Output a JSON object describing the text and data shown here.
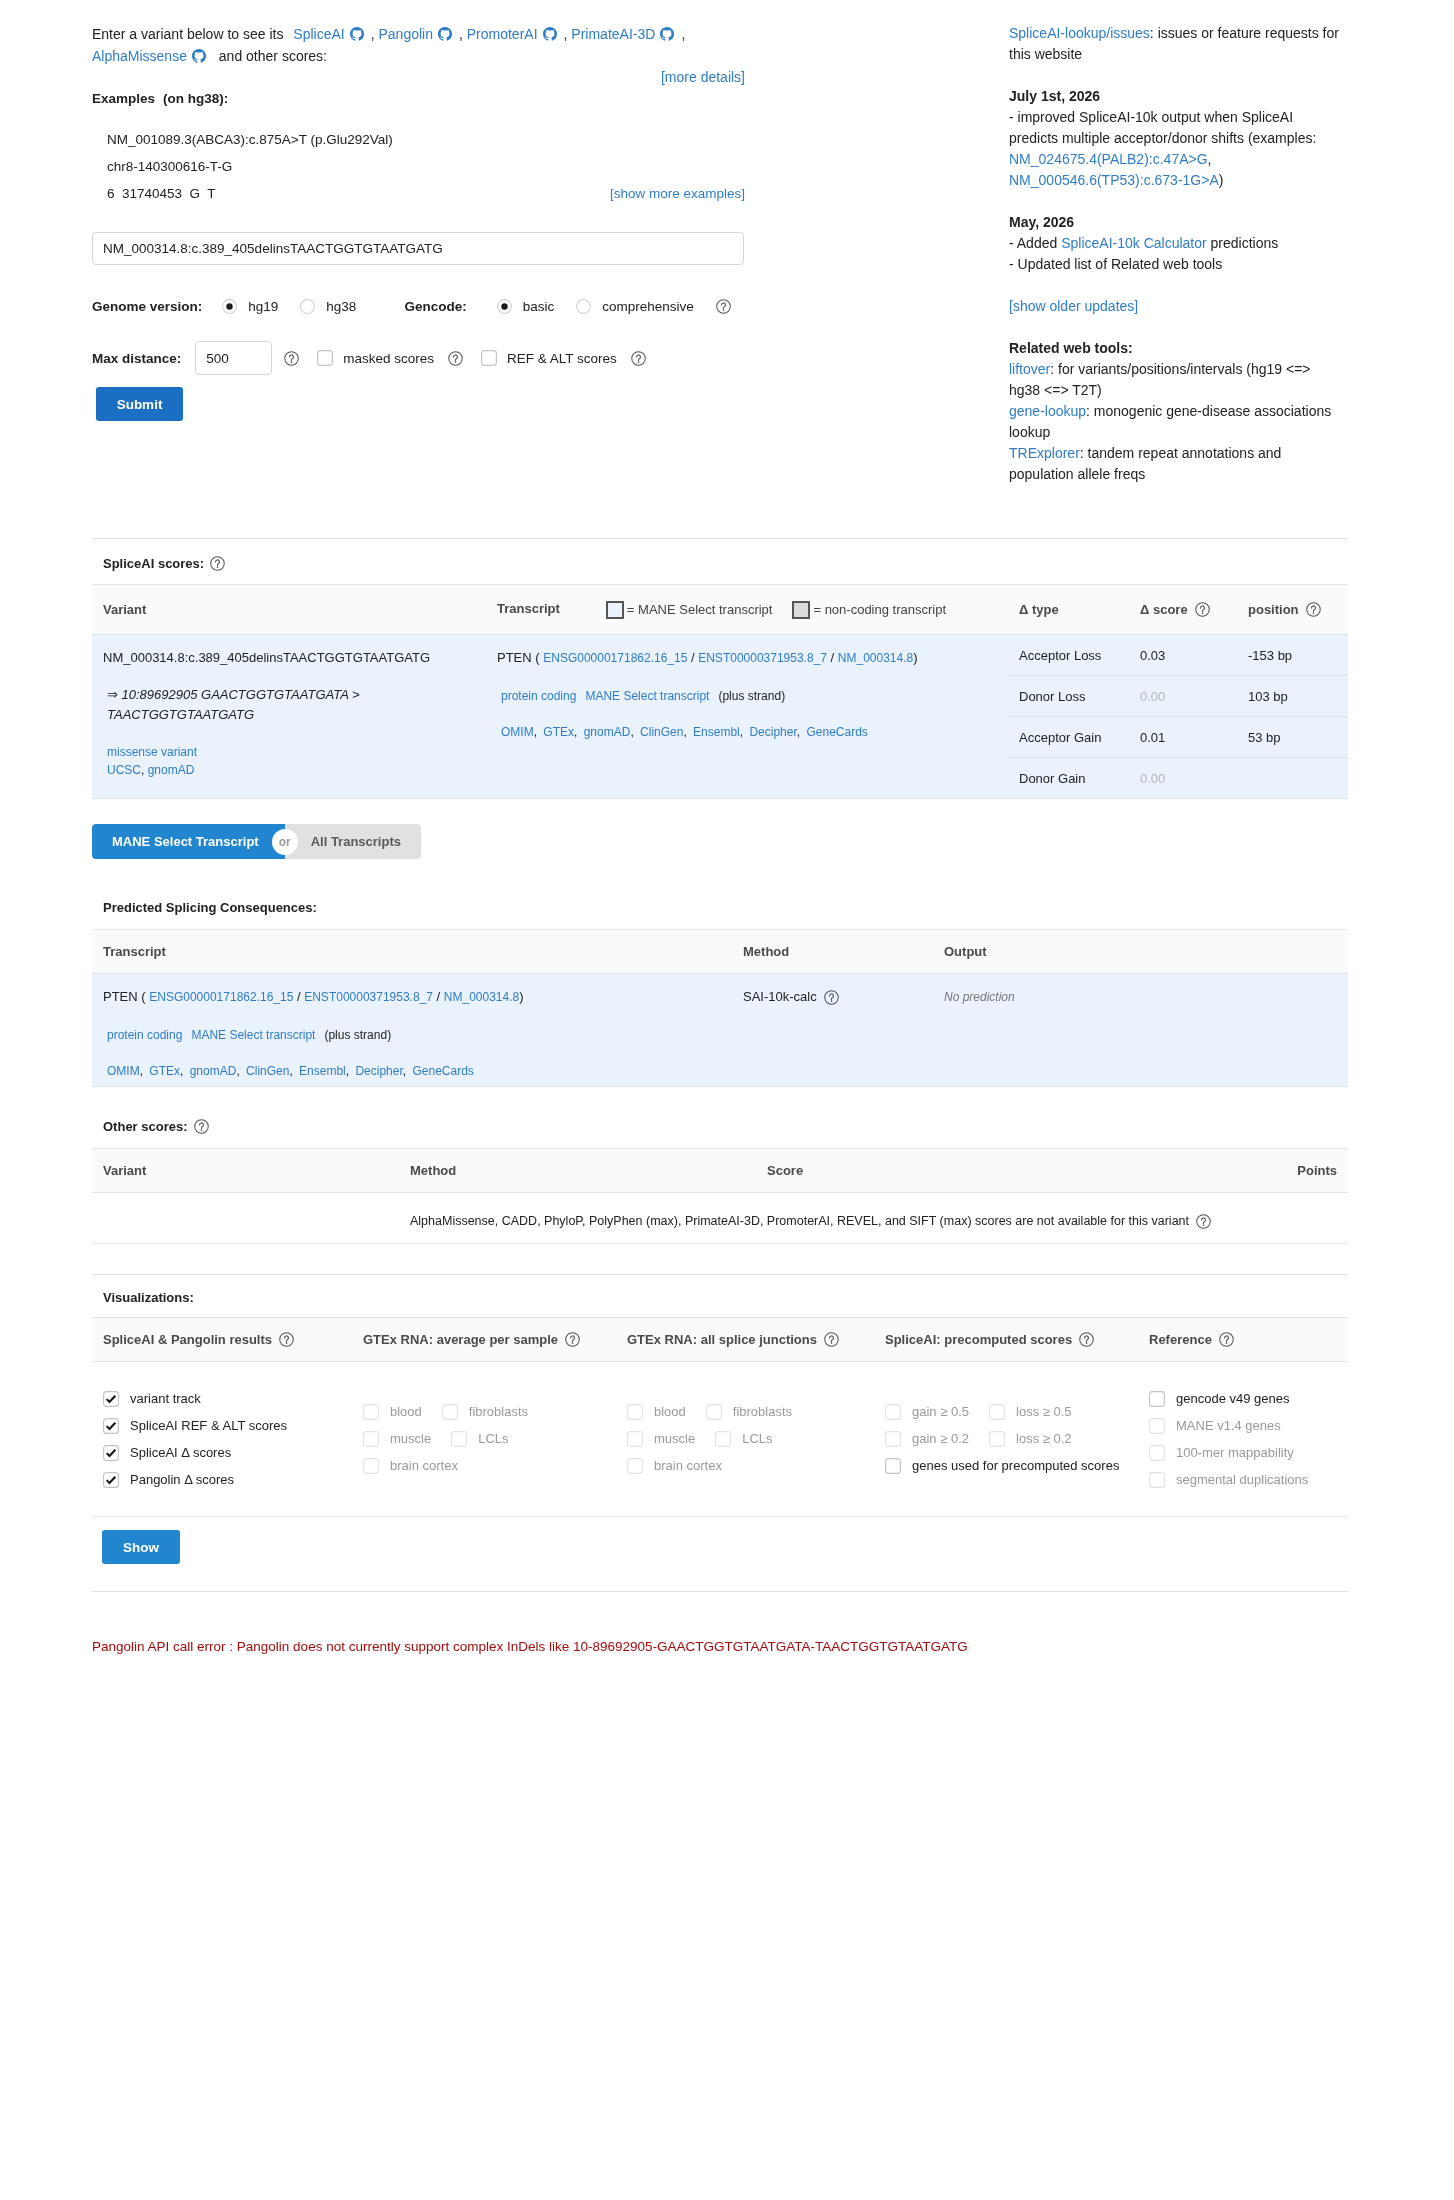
{
  "intro": {
    "lead": "Enter a variant below to see its",
    "tools": [
      {
        "name": "SpliceAI",
        "suffix": ","
      },
      {
        "name": "Pangolin",
        "suffix": ","
      },
      {
        "name": "PromoterAI",
        "suffix": ","
      },
      {
        "name": "PrimateAI-3D",
        "suffix": ","
      },
      {
        "name": "AlphaMissense"
      }
    ],
    "tail": "and other scores:",
    "more_details": "[more details]"
  },
  "examples": {
    "label": "Examples",
    "note": "(on hg38):",
    "items": [
      "NM_001089.3(ABCA3):c.875A>T (p.Glu292Val)",
      "chr8-140300616-T-G",
      "6  31740453  G  T"
    ],
    "more": "[show more examples]"
  },
  "variant_input": {
    "value": "NM_000314.8:c.389_405delinsTAACTGGTGTAATGATG"
  },
  "genome": {
    "label": "Genome version:",
    "options": [
      {
        "label": "hg19",
        "selected": true
      },
      {
        "label": "hg38",
        "selected": false
      }
    ]
  },
  "gencode": {
    "label": "Gencode:",
    "options": [
      {
        "label": "basic",
        "selected": true
      },
      {
        "label": "comprehensive",
        "selected": false
      }
    ]
  },
  "max_distance": {
    "label": "Max distance:",
    "value": "500"
  },
  "options": [
    {
      "label": "masked scores",
      "checked": false
    },
    {
      "label": "REF & ALT scores",
      "checked": false
    }
  ],
  "submit": "Submit",
  "sidebar": {
    "issues": [
      {
        "kind": "link",
        "text": "SpliceAI-lookup/issues"
      },
      {
        "kind": "text",
        "text": ": issues or feature requests for this website"
      }
    ],
    "updates": [
      {
        "date": "July 1st, 2026",
        "lines": [
          [
            {
              "kind": "text",
              "text": "- improved SpliceAI-10k output when SpliceAI predicts multiple acceptor/donor shifts (examples: "
            },
            {
              "kind": "link",
              "text": "NM_024675.4(PALB2):c.47A>G"
            },
            {
              "kind": "text",
              "text": ", "
            },
            {
              "kind": "link",
              "text": "NM_000546.6(TP53):c.673-1G>A"
            },
            {
              "kind": "text",
              "text": ")"
            }
          ]
        ]
      },
      {
        "date": "May, 2026",
        "lines": [
          [
            {
              "kind": "text",
              "text": "- Added "
            },
            {
              "kind": "link",
              "text": "SpliceAI-10k Calculator"
            },
            {
              "kind": "text",
              "text": " predictions"
            }
          ],
          [
            {
              "kind": "text",
              "text": "- Updated list of Related web tools"
            }
          ]
        ]
      }
    ],
    "older": "[show older updates]",
    "related": {
      "title": "Related web tools:",
      "items": [
        [
          {
            "kind": "link",
            "text": "liftover"
          },
          {
            "kind": "text",
            "text": ": for variants/positions/intervals (hg19 <=> hg38 <=> T2T)"
          }
        ],
        [
          {
            "kind": "link",
            "text": "gene-lookup"
          },
          {
            "kind": "text",
            "text": ": monogenic gene-disease associations lookup"
          }
        ],
        [
          {
            "kind": "link",
            "text": "TRExplorer"
          },
          {
            "kind": "text",
            "text": ": tandem repeat annotations and population allele freqs"
          }
        ]
      ]
    }
  },
  "spliceai": {
    "title": "SpliceAI scores:",
    "columns": [
      "Variant",
      "Transcript",
      "Δ type",
      "Δ score",
      "position"
    ],
    "legend": [
      {
        "label": "= MANE Select transcript",
        "color": "#eaf2fd"
      },
      {
        "label": "= non-coding transcript",
        "color": "#dcdcdc"
      }
    ],
    "rows": [
      {
        "mane_select": true,
        "variant": "NM_000314.8:c.389_405delinsTAACTGGTGTAATGATG",
        "normalized": "⇒ 10:89692905 GAACTGGTGTAATGATA > TAACTGGTGTAATGATG",
        "consequence": "missense variant",
        "variant_links": [
          {
            "kind": "link",
            "text": "UCSC"
          },
          {
            "kind": "text",
            "text": ", "
          },
          {
            "kind": "link",
            "text": "gnomAD"
          }
        ],
        "transcript": [
          [
            {
              "kind": "text",
              "text": "PTEN ( "
            },
            {
              "kind": "link",
              "text": "ENSG00000171862.16_15"
            },
            {
              "kind": "text",
              "text": " / "
            },
            {
              "kind": "link",
              "text": "ENST00000371953.8_7"
            },
            {
              "kind": "text",
              "text": " / "
            },
            {
              "kind": "link",
              "text": "NM_000314.8"
            },
            {
              "kind": "text",
              "text": ")"
            }
          ],
          [
            {
              "kind": "link",
              "text": "protein coding"
            },
            {
              "kind": "link",
              "text": "MANE Select transcript"
            },
            {
              "kind": "text",
              "text": "(plus strand)"
            }
          ],
          [
            {
              "kind": "link",
              "text": "OMIM"
            },
            {
              "kind": "text",
              "text": ", "
            },
            {
              "kind": "link",
              "text": "GTEx"
            },
            {
              "kind": "text",
              "text": ", "
            },
            {
              "kind": "link",
              "text": "gnomAD"
            },
            {
              "kind": "text",
              "text": ", "
            },
            {
              "kind": "link",
              "text": "ClinGen"
            },
            {
              "kind": "text",
              "text": ", "
            },
            {
              "kind": "link",
              "text": "Ensembl"
            },
            {
              "kind": "text",
              "text": ", "
            },
            {
              "kind": "link",
              "text": "Decipher"
            },
            {
              "kind": "text",
              "text": ", "
            },
            {
              "kind": "link",
              "text": "GeneCards"
            }
          ]
        ],
        "scores": [
          {
            "type": "Acceptor Loss",
            "score": "0.03",
            "position": "-153 bp",
            "dimmed": false
          },
          {
            "type": "Donor Loss",
            "score": "0.00",
            "position": "103 bp",
            "dimmed": true
          },
          {
            "type": "Acceptor Gain",
            "score": "0.01",
            "position": "53 bp",
            "dimmed": false
          },
          {
            "type": "Donor Gain",
            "score": "0.00",
            "dimmed": true
          }
        ]
      }
    ]
  },
  "toggle": {
    "options": [
      {
        "label": "MANE Select Transcript",
        "selected": true
      },
      {
        "label": "All Transcripts",
        "selected": false
      }
    ],
    "separator": "or"
  },
  "consequences": {
    "title": "Predicted Splicing Consequences:",
    "columns": [
      "Transcript",
      "Method",
      "Output"
    ],
    "rows": [
      {
        "mane_select": true,
        "transcript": [
          [
            {
              "kind": "text",
              "text": "PTEN ( "
            },
            {
              "kind": "link",
              "text": "ENSG00000171862.16_15"
            },
            {
              "kind": "text",
              "text": " / "
            },
            {
              "kind": "link",
              "text": "ENST00000371953.8_7"
            },
            {
              "kind": "text",
              "text": " / "
            },
            {
              "kind": "link",
              "text": "NM_000314.8"
            },
            {
              "kind": "text",
              "text": ")"
            }
          ],
          [
            {
              "kind": "link",
              "text": "protein coding"
            },
            {
              "kind": "link",
              "text": "MANE Select transcript"
            },
            {
              "kind": "text",
              "text": "(plus strand)"
            }
          ],
          [
            {
              "kind": "link",
              "text": "OMIM"
            },
            {
              "kind": "text",
              "text": ", "
            },
            {
              "kind": "link",
              "text": "GTEx"
            },
            {
              "kind": "text",
              "text": ", "
            },
            {
              "kind": "link",
              "text": "gnomAD"
            },
            {
              "kind": "text",
              "text": ", "
            },
            {
              "kind": "link",
              "text": "ClinGen"
            },
            {
              "kind": "text",
              "text": ", "
            },
            {
              "kind": "link",
              "text": "Ensembl"
            },
            {
              "kind": "text",
              "text": ", "
            },
            {
              "kind": "link",
              "text": "Decipher"
            },
            {
              "kind": "text",
              "text": ", "
            },
            {
              "kind": "link",
              "text": "GeneCards"
            }
          ]
        ],
        "method": "SAI-10k-calc",
        "output": "No prediction"
      }
    ]
  },
  "other_scores": {
    "title": "Other scores:",
    "columns": [
      "Variant",
      "Method",
      "Score",
      "Points"
    ],
    "message": "AlphaMissense, CADD, PhyloP, PolyPhen (max), PrimateAI-3D, PromoterAI, REVEL, and SIFT (max) scores are not available for this variant"
  },
  "visualizations": {
    "title": "Visualizations:",
    "groups": [
      {
        "title": "SpliceAI & Pangolin results",
        "items": [
          {
            "label": "variant track",
            "checked": true,
            "disabled": false
          },
          {
            "label": "SpliceAI REF & ALT scores",
            "checked": true,
            "disabled": false
          },
          {
            "label": "SpliceAI Δ scores",
            "checked": true,
            "disabled": false
          },
          {
            "label": "Pangolin Δ scores",
            "checked": true,
            "disabled": false
          }
        ]
      },
      {
        "title": "GTEx RNA: average per sample",
        "items": [
          {
            "label": "blood",
            "checked": false,
            "disabled": true
          },
          {
            "label": "fibroblasts",
            "checked": false,
            "disabled": true
          },
          {
            "label": "muscle",
            "checked": false,
            "disabled": true
          },
          {
            "label": "LCLs",
            "checked": false,
            "disabled": true
          },
          {
            "label": "brain cortex",
            "checked": false,
            "disabled": true
          }
        ]
      },
      {
        "title": "GTEx RNA: all splice junctions",
        "items": [
          {
            "label": "blood",
            "checked": false,
            "disabled": true
          },
          {
            "label": "fibroblasts",
            "checked": false,
            "disabled": true
          },
          {
            "label": "muscle",
            "checked": false,
            "disabled": true
          },
          {
            "label": "LCLs",
            "checked": false,
            "disabled": true
          },
          {
            "label": "brain cortex",
            "checked": false,
            "disabled": true
          }
        ]
      },
      {
        "title": "SpliceAI: precomputed scores",
        "items": [
          {
            "label": "gain ≥ 0.5",
            "checked": false,
            "disabled": true
          },
          {
            "label": "loss ≥ 0.5",
            "checked": false,
            "disabled": true
          },
          {
            "label": "gain ≥ 0.2",
            "checked": false,
            "disabled": true
          },
          {
            "label": "loss ≥ 0.2",
            "checked": false,
            "disabled": true
          },
          {
            "label": "genes used for precomputed scores",
            "checked": false,
            "disabled": false
          }
        ]
      },
      {
        "title": "Reference",
        "items": [
          {
            "label": "gencode v49 genes",
            "checked": false,
            "disabled": false
          },
          {
            "label": "MANE v1.4 genes",
            "checked": false,
            "disabled": true
          },
          {
            "label": "100-mer mappability",
            "checked": false,
            "disabled": true
          },
          {
            "label": "segmental duplications",
            "checked": false,
            "disabled": true
          }
        ]
      }
    ],
    "button": "Show"
  },
  "error": "Pangolin API call error : Pangolin does not currently support complex InDels like 10-89692905-GAACTGGTGTAATGATA-TAACTGGTGTAATGATG"
}
